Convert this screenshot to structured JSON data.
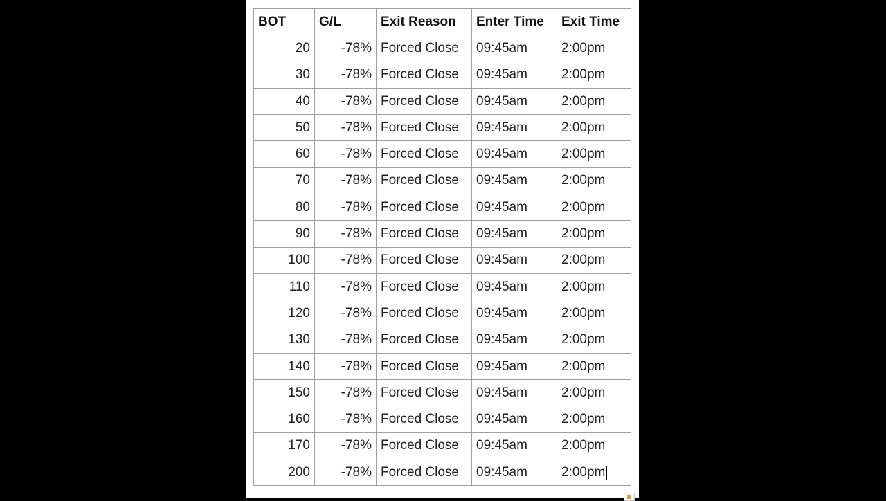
{
  "table": {
    "headers": [
      "BOT",
      "G/L",
      "Exit Reason",
      "Enter Time",
      "Exit Time"
    ],
    "rows": [
      [
        "20",
        "-78%",
        "Forced Close",
        "09:45am",
        "2:00pm"
      ],
      [
        "30",
        "-78%",
        "Forced Close",
        "09:45am",
        "2:00pm"
      ],
      [
        "40",
        "-78%",
        "Forced Close",
        "09:45am",
        "2:00pm"
      ],
      [
        "50",
        "-78%",
        "Forced Close",
        "09:45am",
        "2:00pm"
      ],
      [
        "60",
        "-78%",
        "Forced Close",
        "09:45am",
        "2:00pm"
      ],
      [
        "70",
        "-78%",
        "Forced Close",
        "09:45am",
        "2:00pm"
      ],
      [
        "80",
        "-78%",
        "Forced Close",
        "09:45am",
        "2:00pm"
      ],
      [
        "90",
        "-78%",
        "Forced Close",
        "09:45am",
        "2:00pm"
      ],
      [
        "100",
        "-78%",
        "Forced Close",
        "09:45am",
        "2:00pm"
      ],
      [
        "110",
        "-78%",
        "Forced Close",
        "09:45am",
        "2:00pm"
      ],
      [
        "120",
        "-78%",
        "Forced Close",
        "09:45am",
        "2:00pm"
      ],
      [
        "130",
        "-78%",
        "Forced Close",
        "09:45am",
        "2:00pm"
      ],
      [
        "140",
        "-78%",
        "Forced Close",
        "09:45am",
        "2:00pm"
      ],
      [
        "150",
        "-78%",
        "Forced Close",
        "09:45am",
        "2:00pm"
      ],
      [
        "160",
        "-78%",
        "Forced Close",
        "09:45am",
        "2:00pm"
      ],
      [
        "170",
        "-78%",
        "Forced Close",
        "09:45am",
        "2:00pm"
      ],
      [
        "200",
        "-78%",
        "Forced Close",
        "09:45am",
        "2:00pm"
      ]
    ]
  },
  "paste_options_icon": "paste-options-icon"
}
